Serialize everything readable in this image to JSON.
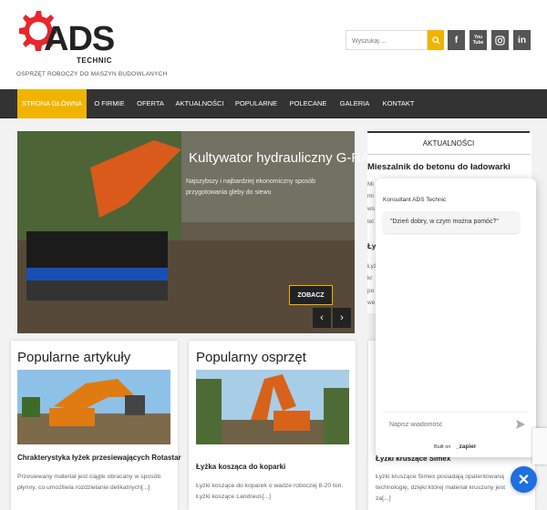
{
  "header": {
    "logo_text": "ADS",
    "logo_sub": "TECHNIC",
    "tagline": "OSPRZĘT ROBOCZY DO MASZYN BUDOWLANYCH",
    "search_placeholder": "Wyszukaj ...",
    "social": [
      "f",
      "You Tube",
      "instagram",
      "in"
    ]
  },
  "nav": {
    "items": [
      "STRONA GŁÓWNA",
      "O FIRMIE",
      "OFERTA",
      "AKTUALNOŚCI",
      "POPULARNE",
      "POLECANE",
      "GALERIA",
      "KONTAKT"
    ],
    "active_index": 0
  },
  "slider": {
    "title": "Kultywator hydrauliczny G-RAKE",
    "description": "Najszybszy i najbardziej ekonomiczny sposób przygotowania gleby do siewu",
    "button": "ZOBACZ",
    "prev": "‹",
    "next": "›"
  },
  "sidebar": {
    "heading": "AKTUALNOŚCI",
    "post_title": "Mieszalnik do betonu do ładowarki",
    "fragments": [
      "Mi",
      "mi",
      "ws",
      "tel",
      "Łyż",
      "Łyż",
      "kr",
      "po",
      "we"
    ]
  },
  "cards": [
    {
      "heading": "Popularne artykuły",
      "title": "Chrakterystyka łyżek przesiewających Rotastar",
      "excerpt": "Przesiewany materiał jest ciągle obracany w sposób płynny, co umożliwia rozdzielanie delikatnych[...]"
    },
    {
      "heading": "Popularny osprzęt",
      "title": "Łyżka kosząca do koparki",
      "excerpt": "Łyżki koszące do koparek o wadze roboczej 8-20 ton. Łyżki koszące Landreus[...]"
    },
    {
      "heading": "",
      "title": "Łyżki kruszące Simex",
      "excerpt": "Łyżki kruszące Simex posiadają opatentowaną technologię, dzięki której materiał kruszony jest za[...]"
    }
  ],
  "chat": {
    "title": "Konsultant ADS Technic",
    "greeting": "\"Dzień dobry, w czym można pomóc?\"",
    "input_placeholder": "Napisz wiadomość",
    "built_on": "Built on",
    "brand": "_zapier",
    "close": "✕"
  },
  "colors": {
    "accent": "#f0b400",
    "nav_bg": "#333333",
    "logo_red": "#e8262d",
    "chat_blue": "#1e6fe0"
  }
}
